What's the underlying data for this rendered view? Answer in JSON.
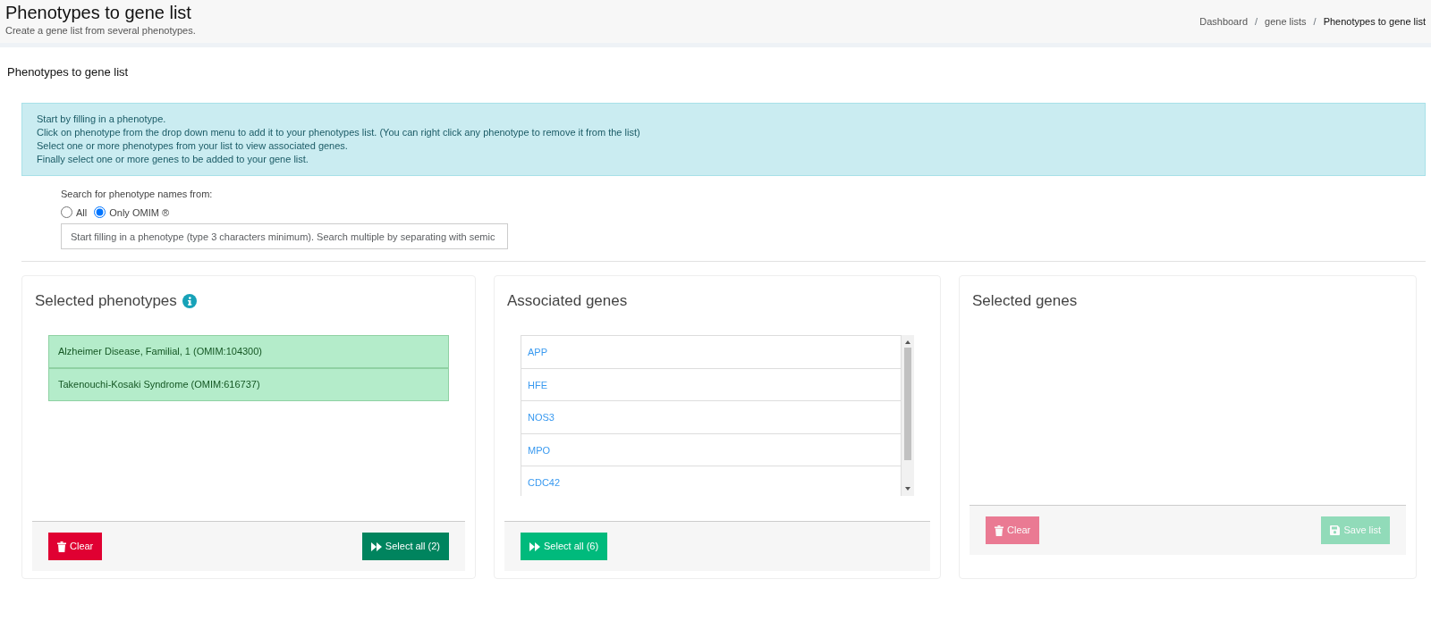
{
  "header": {
    "title": "Phenotypes to gene list",
    "subtitle": "Create a gene list from several phenotypes.",
    "breadcrumb_separator": "/",
    "breadcrumb": [
      {
        "label": "Dashboard",
        "active": false
      },
      {
        "label": "gene lists",
        "active": false
      },
      {
        "label": "Phenotypes to gene list",
        "active": true
      }
    ]
  },
  "section_title": "Phenotypes to gene list",
  "instructions": [
    "Start by filling in a phenotype.",
    "Click on phenotype from the drop down menu to add it to your phenotypes list. (You can right click any phenotype to remove it from the list)",
    "Select one or more phenotypes from your list to view associated genes.",
    "Finally select one or more genes to be added to your gene list."
  ],
  "search": {
    "label": "Search for phenotype names from:",
    "options": [
      {
        "label": "All",
        "selected": false
      },
      {
        "label": "Only OMIM ®",
        "selected": true
      }
    ],
    "placeholder": "Start filling in a phenotype (type 3 characters minimum). Search multiple by separating with semic"
  },
  "panels": [
    {
      "title": "Selected phenotypes",
      "info": true,
      "items": [
        {
          "label": "Alzheimer Disease, Familial, 1 (OMIM:104300)",
          "selected": true
        },
        {
          "label": "Takenouchi-Kosaki Syndrome (OMIM:616737)",
          "selected": true
        }
      ],
      "buttons": [
        {
          "kind": "clear",
          "label": "Clear",
          "disabled": false
        },
        {
          "kind": "select",
          "label": "Select all (2)",
          "disabled": false
        }
      ]
    },
    {
      "title": "Associated genes",
      "info": false,
      "scroll": true,
      "items": [
        {
          "label": "APP",
          "selected": false
        },
        {
          "label": "HFE",
          "selected": false
        },
        {
          "label": "NOS3",
          "selected": false
        },
        {
          "label": "MPO",
          "selected": false
        },
        {
          "label": "CDC42",
          "selected": false
        }
      ],
      "buttons": [
        {
          "kind": "select-bright",
          "label": "Select all (6)",
          "disabled": false
        }
      ]
    },
    {
      "title": "Selected genes",
      "info": false,
      "buttons": [
        {
          "kind": "clear",
          "label": "Clear",
          "disabled": true
        },
        {
          "kind": "save",
          "label": "Save list",
          "disabled": true
        }
      ]
    }
  ]
}
